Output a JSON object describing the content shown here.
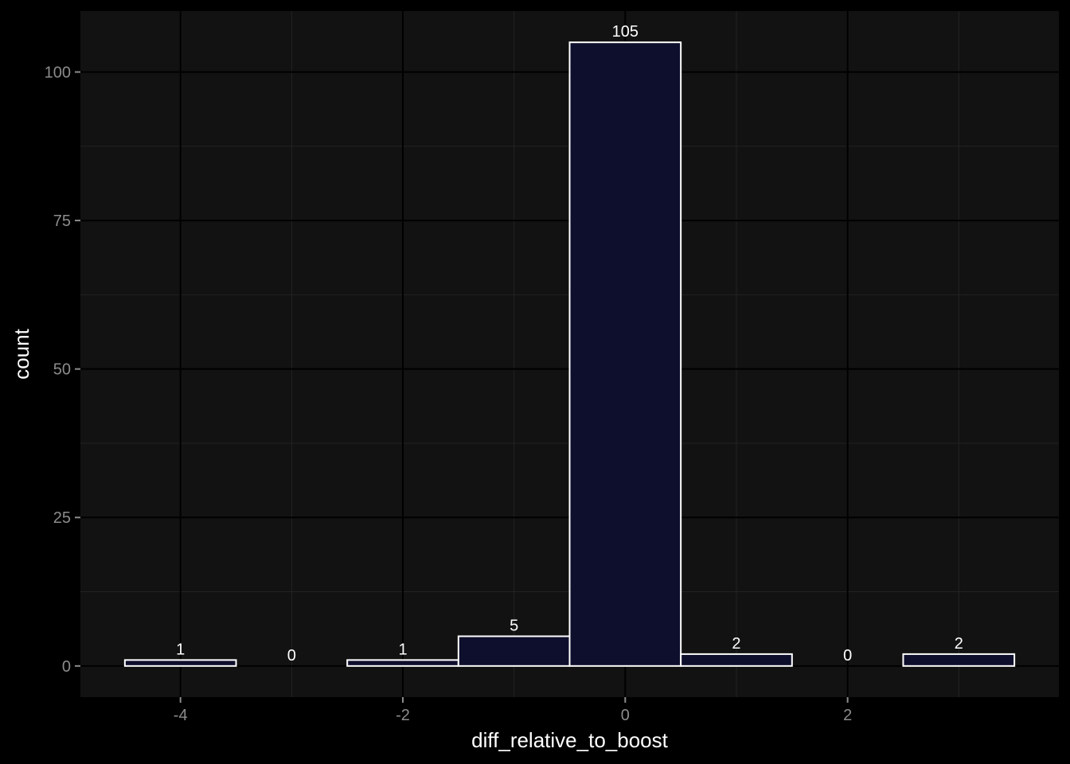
{
  "chart_data": {
    "type": "bar",
    "title": "",
    "xlabel": "diff_relative_to_boost",
    "ylabel": "count",
    "x_centers": [
      -4,
      -3,
      -2,
      -1,
      0,
      1,
      2,
      3
    ],
    "bin_width": 1,
    "values": [
      1,
      0,
      1,
      5,
      105,
      2,
      0,
      2
    ],
    "data_labels": [
      "1",
      "0",
      "1",
      "5",
      "105",
      "2",
      "0",
      "2"
    ],
    "xlim": [
      -4.9,
      3.9
    ],
    "ylim": [
      -5.25,
      110.25
    ],
    "x_ticks": [
      -4,
      -2,
      0,
      2
    ],
    "x_tick_labels": [
      "-4",
      "-2",
      "0",
      "2"
    ],
    "y_ticks": [
      0,
      25,
      50,
      75,
      100
    ],
    "y_tick_labels": [
      "0",
      "25",
      "50",
      "75",
      "100"
    ],
    "grid": true,
    "legend": "none",
    "colors": {
      "background": "#000000",
      "panel": "#121212",
      "grid_major": "#000000",
      "grid_minor": "#232323",
      "bar_fill": "#0e0f2c",
      "bar_outline": "#ffffff",
      "tick_label": "#8c8c8c",
      "axis_title": "#ffffff"
    }
  }
}
